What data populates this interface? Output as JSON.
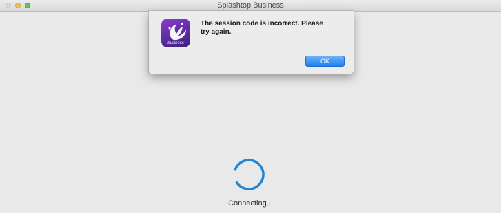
{
  "window": {
    "title": "Splashtop Business"
  },
  "dialog": {
    "message": "The session code is incorrect. Please try again.",
    "ok_label": "OK",
    "app_icon": {
      "name": "splashtop-business-icon",
      "caption": "business"
    }
  },
  "status": {
    "text": "Connecting..."
  },
  "colors": {
    "spinner": "#1f86d6",
    "ok_button": "#1f7ff0",
    "icon_purple": "#6a2fb0"
  }
}
